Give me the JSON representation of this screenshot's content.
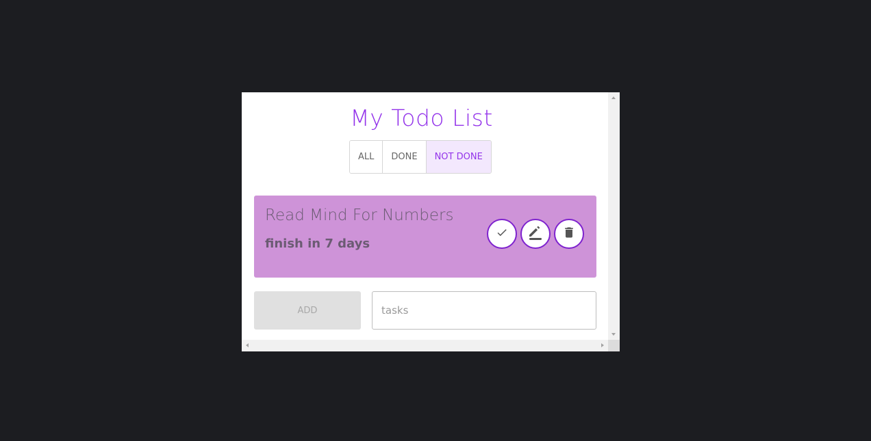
{
  "app": {
    "title": "My Todo List"
  },
  "filters": {
    "all_label": "ALL",
    "done_label": "DONE",
    "not_done_label": "NOT DONE",
    "active": "NOT DONE"
  },
  "todos": [
    {
      "title": "Read Mind For Numbers",
      "subtitle": "finish in 7 days",
      "actions": [
        "check-icon",
        "pencil-icon",
        "trash-icon"
      ]
    }
  ],
  "form": {
    "add_label": "ADD",
    "input_placeholder": "tasks",
    "input_value": ""
  },
  "colors": {
    "background": "#1c1d21",
    "accent": "#9333ea",
    "card": "#ce93d8",
    "active_filter_bg": "#f3e8fd"
  }
}
